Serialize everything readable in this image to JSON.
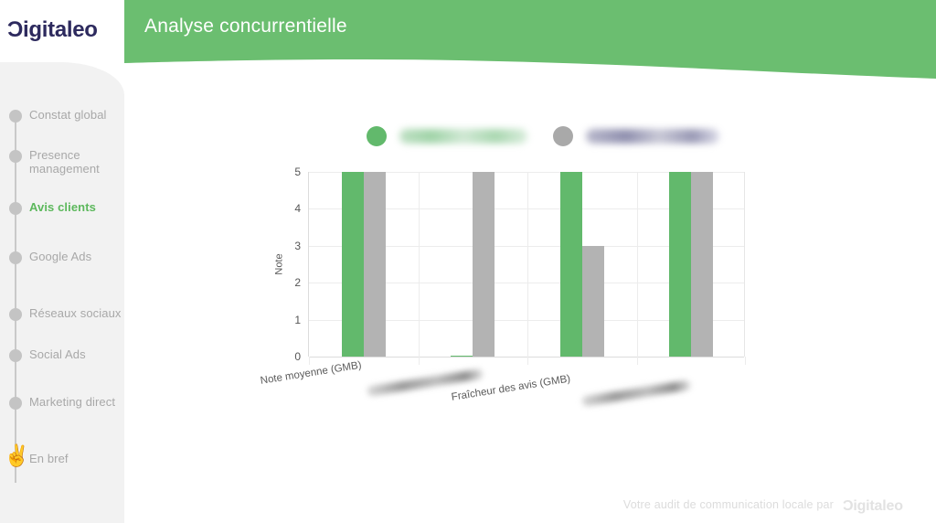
{
  "brand": {
    "logo_text": "Digitaleo",
    "logo_color": "#2d2a5e",
    "accent_green": "#62b96c",
    "header_green": "#6bbe70",
    "bar_gray": "#b3b3b3",
    "active_green": "#5cb85c"
  },
  "header": {
    "title": "Analyse concurrentielle"
  },
  "sidebar": {
    "items": [
      {
        "label": "Constat global",
        "active": false,
        "icon": "dot-icon",
        "name": "constat-global"
      },
      {
        "label": "Presence management",
        "active": false,
        "icon": "dot-icon",
        "name": "presence-management"
      },
      {
        "label": "Avis clients",
        "active": true,
        "icon": "dot-icon",
        "name": "avis-clients"
      },
      {
        "label": "Google Ads",
        "active": false,
        "icon": "dot-icon",
        "name": "google-ads"
      },
      {
        "label": "Réseaux sociaux",
        "active": false,
        "icon": "dot-icon",
        "name": "reseaux-sociaux"
      },
      {
        "label": "Social Ads",
        "active": false,
        "icon": "dot-icon",
        "name": "social-ads"
      },
      {
        "label": "Marketing direct",
        "active": false,
        "icon": "dot-icon",
        "name": "marketing-direct"
      },
      {
        "label": "En bref",
        "active": false,
        "icon": "victory-hand-emoji",
        "emoji": "✌️",
        "name": "en-bref"
      }
    ]
  },
  "footer": {
    "text": "Votre audit de communication locale par",
    "logo_text": "Digitaleo"
  },
  "chart_data": {
    "type": "bar",
    "title": "",
    "xlabel": "",
    "ylabel": "Note",
    "ylim": [
      0,
      5
    ],
    "yticks": [
      0,
      1,
      2,
      3,
      4,
      5
    ],
    "grid": true,
    "legend_position": "top",
    "categories": [
      "Note moyenne (GMB)",
      "[redacted]",
      "Fraîcheur des avis (GMB)",
      "[redacted]"
    ],
    "categories_redacted": [
      false,
      true,
      false,
      true
    ],
    "series": [
      {
        "name": "[redacted]",
        "color": "#62b96c",
        "redacted": true,
        "values": [
          5,
          0,
          5,
          5
        ]
      },
      {
        "name": "[redacted]",
        "color": "#b3b3b3",
        "redacted": true,
        "values": [
          5,
          5,
          3,
          5
        ]
      }
    ]
  }
}
